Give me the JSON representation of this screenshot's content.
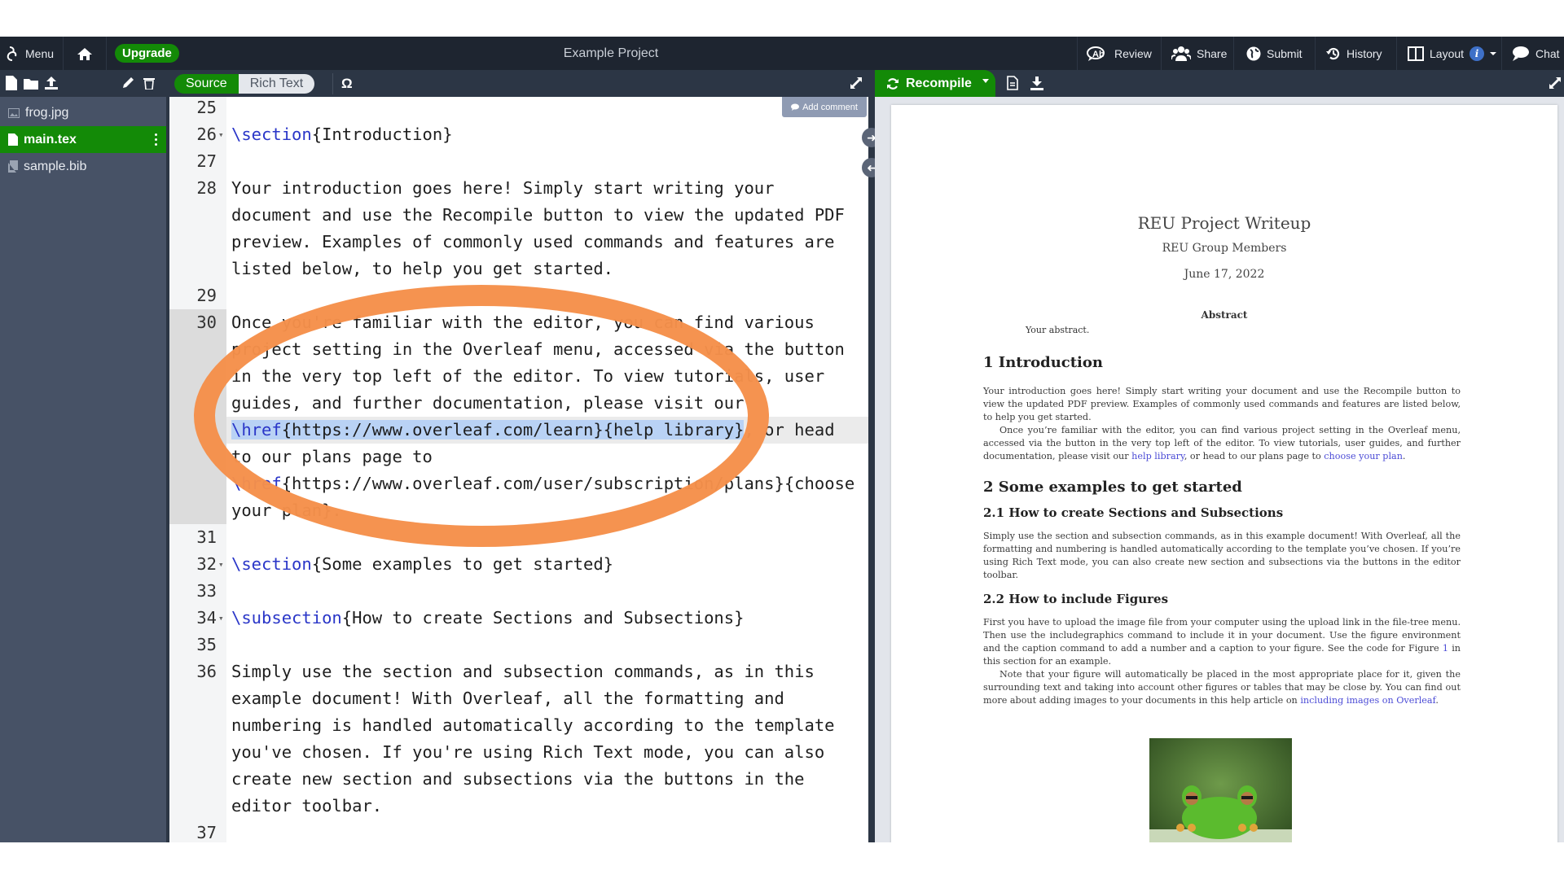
{
  "topnav": {
    "menu_label": "Menu",
    "upgrade_label": "Upgrade",
    "project_title": "Example Project",
    "review_label": "Review",
    "share_label": "Share",
    "submit_label": "Submit",
    "history_label": "History",
    "layout_label": "Layout",
    "layout_info": "i",
    "chat_label": "Chat"
  },
  "toolbar": {
    "source_label": "Source",
    "rich_text_label": "Rich Text",
    "symbol_label": "Ω",
    "recompile_label": "Recompile"
  },
  "sidebar": {
    "files": [
      {
        "name": "frog.jpg",
        "type": "image"
      },
      {
        "name": "main.tex",
        "type": "file",
        "active": true
      },
      {
        "name": "sample.bib",
        "type": "bib"
      }
    ]
  },
  "editor": {
    "add_comment_label": "Add comment",
    "lines": [
      {
        "n": "25",
        "text": ""
      },
      {
        "n": "26",
        "kw": "\\section",
        "text": "{Introduction}",
        "fold": true
      },
      {
        "n": "27",
        "text": ""
      },
      {
        "n": "28",
        "text": "Your introduction goes here! Simply start writing your"
      },
      {
        "n": "",
        "text": "document and use the Recompile button to view the updated PDF"
      },
      {
        "n": "",
        "text": "preview. Examples of commonly used commands and features are"
      },
      {
        "n": "",
        "text": "listed below, to help you get started."
      },
      {
        "n": "29",
        "text": ""
      },
      {
        "n": "30",
        "text": "Once you're familiar with the editor, you can find various"
      },
      {
        "n": "",
        "text": "project setting in the Overleaf menu, accessed via the button"
      },
      {
        "n": "",
        "text": "in the very top left of the editor. To view tutorials, user"
      },
      {
        "n": "",
        "text": "guides, and further documentation, please visit our"
      },
      {
        "n": "",
        "kw": "\\href",
        "text": "{https://www.overleaf.com/learn}{help library}",
        "tail": ", or head",
        "selected": true
      },
      {
        "n": "",
        "text": "to our plans page to"
      },
      {
        "n": "",
        "kw": "\\href",
        "text": "{https://www.overleaf.com/user/subscription/plans}{choose"
      },
      {
        "n": "",
        "text": "your plan}."
      },
      {
        "n": "31",
        "text": ""
      },
      {
        "n": "32",
        "kw": "\\section",
        "text": "{Some examples to get started}",
        "fold": true
      },
      {
        "n": "33",
        "text": ""
      },
      {
        "n": "34",
        "kw": "\\subsection",
        "text": "{How to create Sections and Subsections}",
        "fold": true
      },
      {
        "n": "35",
        "text": ""
      },
      {
        "n": "36",
        "text": "Simply use the section and subsection commands, as in this"
      },
      {
        "n": "",
        "text": "example document! With Overleaf, all the formatting and"
      },
      {
        "n": "",
        "text": "numbering is handled automatically according to the template"
      },
      {
        "n": "",
        "text": "you've chosen. If you're using Rich Text mode, you can also"
      },
      {
        "n": "",
        "text": "create new section and subsections via the buttons in the"
      },
      {
        "n": "",
        "text": "editor toolbar."
      },
      {
        "n": "37",
        "text": ""
      }
    ]
  },
  "pdf": {
    "title": "REU Project Writeup",
    "author": "REU Group Members",
    "date": "June 17, 2022",
    "abstract_heading": "Abstract",
    "abstract_text": "Your abstract.",
    "sec1_heading": "1   Introduction",
    "sec1_p1": "Your introduction goes here! Simply start writing your document and use the Recompile button to view the updated PDF preview. Examples of commonly used commands and features are listed below, to help you get started.",
    "sec1_p2_a": "Once you’re familiar with the editor, you can find various project setting in the Overleaf menu, accessed via the button in the very top left of the editor. To view tutorials, user guides, and further documentation, please visit our ",
    "sec1_p2_link1": "help library",
    "sec1_p2_b": ", or head to our plans page to ",
    "sec1_p2_link2": "choose your plan",
    "sec1_p2_c": ".",
    "sec2_heading": "2   Some examples to get started",
    "sec21_heading": "2.1   How to create Sections and Subsections",
    "sec21_p": "Simply use the section and subsection commands, as in this example document! With Overleaf, all the formatting and numbering is handled automatically according to the template you’ve chosen. If you’re using Rich Text mode, you can also create new section and subsections via the buttons in the editor toolbar.",
    "sec22_heading": "2.2   How to include Figures",
    "sec22_p1_a": "First you have to upload the image file from your computer using the upload link in the file-tree menu. Then use the includegraphics command to include it in your document. Use the figure environment and the caption command to add a number and a caption to your figure. See the code for Figure ",
    "sec22_p1_ref": "1",
    "sec22_p1_b": " in this section for an example.",
    "sec22_p2_a": "Note that your figure will automatically be placed in the most appropriate place for it, given the surrounding text and taking into account other figures or tables that may be close by. You can find out more about adding images to your documents in this help article on ",
    "sec22_p2_link": "including images on Overleaf",
    "sec22_p2_b": "."
  },
  "colors": {
    "accent_green": "#138a07",
    "nav_bg": "#1e2530",
    "sidebar_bg": "#475266",
    "annotation_orange": "#f5904a",
    "link_blue": "#4c4cd6"
  }
}
